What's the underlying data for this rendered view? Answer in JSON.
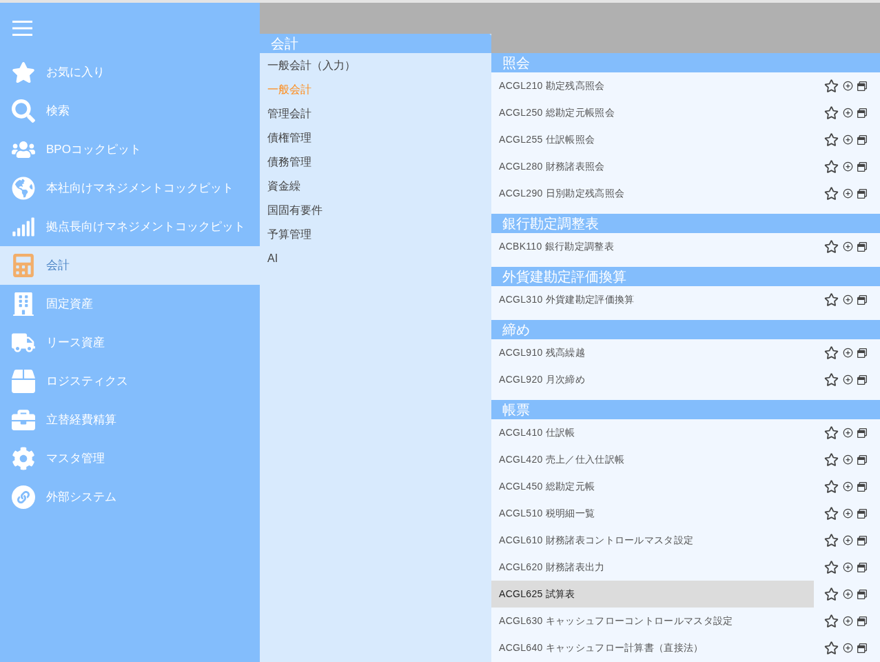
{
  "sidebar": {
    "items": [
      {
        "label": "お気に入り",
        "selected": false
      },
      {
        "label": "検索",
        "selected": false
      },
      {
        "label": "BPOコックピット",
        "selected": false
      },
      {
        "label": "本社向けマネジメントコックピット",
        "selected": false
      },
      {
        "label": "拠点長向けマネジメントコックピット",
        "selected": false
      },
      {
        "label": "会計",
        "selected": true
      },
      {
        "label": "固定資産",
        "selected": false
      },
      {
        "label": "リース資産",
        "selected": false
      },
      {
        "label": "ロジスティクス",
        "selected": false
      },
      {
        "label": "立替経費精算",
        "selected": false
      },
      {
        "label": "マスタ管理",
        "selected": false
      },
      {
        "label": "外部システム",
        "selected": false
      }
    ]
  },
  "category_panel": {
    "title": "会計",
    "items": [
      {
        "label": "一般会計（入力）",
        "selected": false
      },
      {
        "label": "一般会計",
        "selected": true
      },
      {
        "label": "管理会計",
        "selected": false
      },
      {
        "label": "債権管理",
        "selected": false
      },
      {
        "label": "債務管理",
        "selected": false
      },
      {
        "label": "資金繰",
        "selected": false
      },
      {
        "label": "国固有要件",
        "selected": false
      },
      {
        "label": "予算管理",
        "selected": false
      },
      {
        "label": "AI",
        "selected": false
      }
    ]
  },
  "program_panel": {
    "sections": [
      {
        "title": "照会",
        "items": [
          {
            "label": "ACGL210 勘定残高照会",
            "selected": false
          },
          {
            "label": "ACGL250 総勘定元帳照会",
            "selected": false
          },
          {
            "label": "ACGL255 仕訳帳照会",
            "selected": false
          },
          {
            "label": "ACGL280 財務諸表照会",
            "selected": false
          },
          {
            "label": "ACGL290 日別勘定残高照会",
            "selected": false
          }
        ]
      },
      {
        "title": "銀行勘定調整表",
        "items": [
          {
            "label": "ACBK110 銀行勘定調整表",
            "selected": false
          }
        ]
      },
      {
        "title": "外貨建勘定評価換算",
        "items": [
          {
            "label": "ACGL310 外貨建勘定評価換算",
            "selected": false
          }
        ]
      },
      {
        "title": "締め",
        "items": [
          {
            "label": "ACGL910 残高繰越",
            "selected": false
          },
          {
            "label": "ACGL920 月次締め",
            "selected": false
          }
        ]
      },
      {
        "title": "帳票",
        "items": [
          {
            "label": "ACGL410 仕訳帳",
            "selected": false
          },
          {
            "label": "ACGL420 売上／仕入仕訳帳",
            "selected": false
          },
          {
            "label": "ACGL450 総勘定元帳",
            "selected": false
          },
          {
            "label": "ACGL510 税明細一覧",
            "selected": false
          },
          {
            "label": "ACGL610 財務諸表コントロールマスタ設定",
            "selected": false
          },
          {
            "label": "ACGL620 財務諸表出力",
            "selected": false
          },
          {
            "label": "ACGL625 試算表",
            "selected": true
          },
          {
            "label": "ACGL630 キャッシュフローコントロールマスタ設定",
            "selected": false
          },
          {
            "label": "ACGL640 キャッシュフロー計算書（直接法）",
            "selected": false
          }
        ]
      }
    ]
  }
}
